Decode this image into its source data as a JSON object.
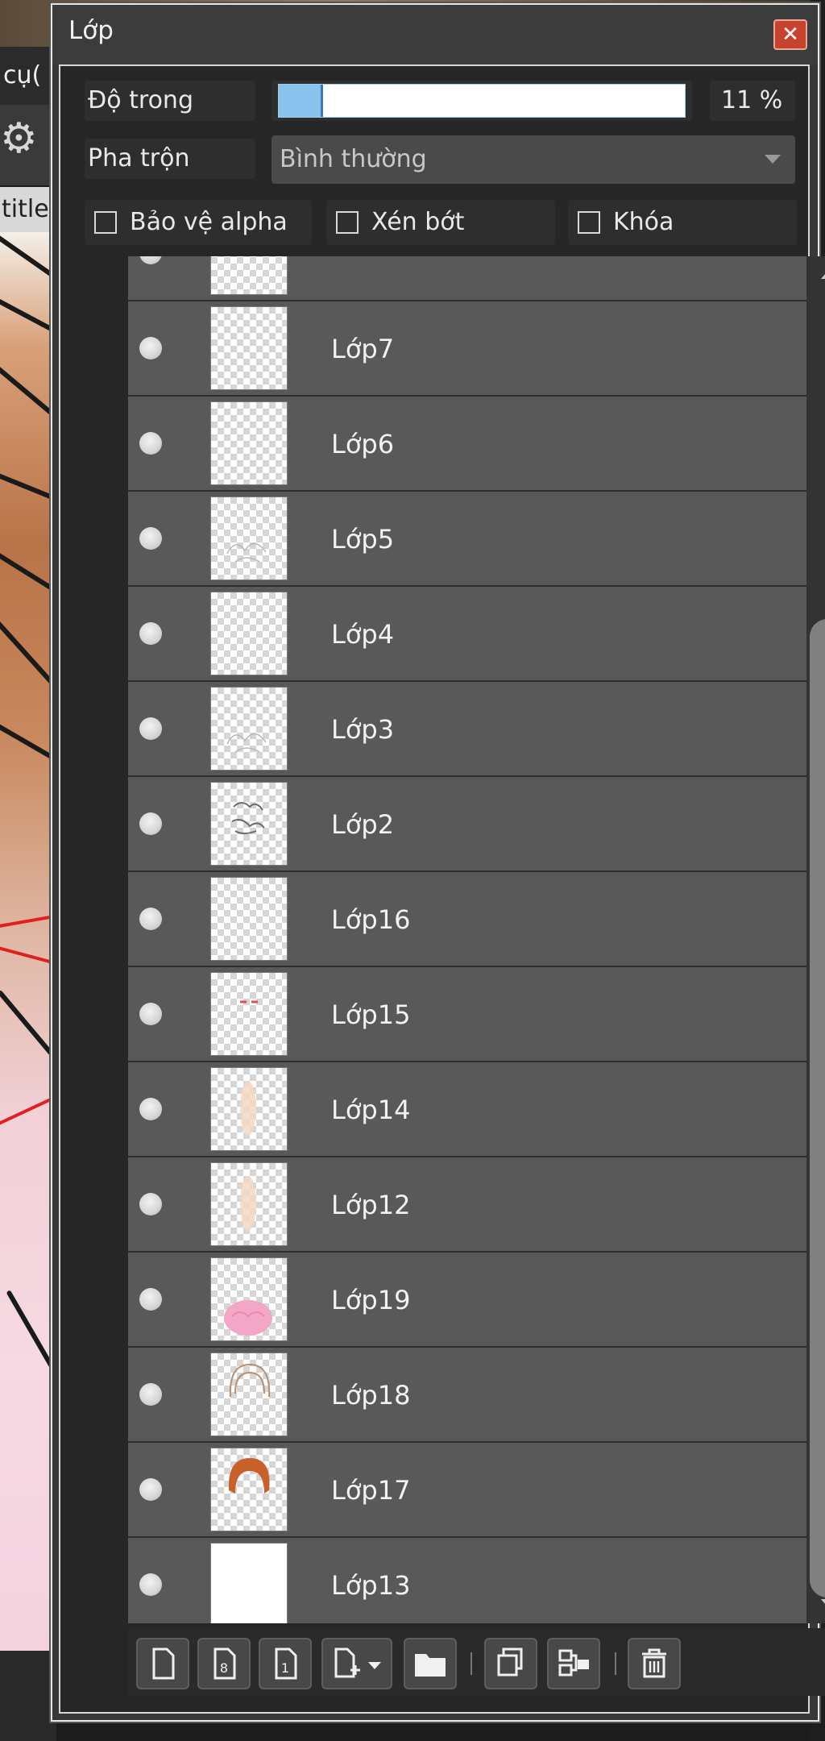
{
  "background_app": {
    "menu_fragment": "cụ(",
    "tab_fragment": "titled"
  },
  "panel": {
    "title": "Lớp",
    "close_icon": "close-icon",
    "opacity": {
      "label": "Độ trong",
      "value_text": "11 %",
      "fraction": 0.11
    },
    "blend": {
      "label": "Pha trộn",
      "value": "Bình thường"
    },
    "checkboxes": [
      {
        "label": "Bảo vệ alpha",
        "checked": false
      },
      {
        "label": "Xén bớt",
        "checked": false
      },
      {
        "label": "Khóa",
        "checked": false
      }
    ]
  },
  "layers": [
    {
      "name": "",
      "thumb": "checker"
    },
    {
      "name": "Lớp7",
      "thumb": "checker"
    },
    {
      "name": "Lớp6",
      "thumb": "checker"
    },
    {
      "name": "Lớp5",
      "thumb": "checker-sketch"
    },
    {
      "name": "Lớp4",
      "thumb": "checker"
    },
    {
      "name": "Lớp3",
      "thumb": "checker-sketch"
    },
    {
      "name": "Lớp2",
      "thumb": "checker-sketch-dark"
    },
    {
      "name": "Lớp16",
      "thumb": "checker"
    },
    {
      "name": "Lớp15",
      "thumb": "checker-red-mark"
    },
    {
      "name": "Lớp14",
      "thumb": "checker-skin"
    },
    {
      "name": "Lớp12",
      "thumb": "checker-skin"
    },
    {
      "name": "Lớp19",
      "thumb": "checker-pink"
    },
    {
      "name": "Lớp18",
      "thumb": "checker-hair-outline"
    },
    {
      "name": "Lớp17",
      "thumb": "checker-orange-hair"
    },
    {
      "name": "Lớp13",
      "thumb": "white"
    }
  ],
  "scroll": {
    "position_fraction": 0.8
  },
  "toolbar": {
    "buttons": [
      {
        "name": "new-layer-button",
        "icon": "page-icon"
      },
      {
        "name": "new-8bit-layer-button",
        "icon": "page-8-icon"
      },
      {
        "name": "new-1bit-layer-button",
        "icon": "page-1-icon"
      },
      {
        "name": "add-layer-menu-button",
        "icon": "page-plus-icon"
      },
      {
        "name": "new-folder-button",
        "icon": "folder-icon"
      },
      {
        "name": "duplicate-layer-button",
        "icon": "duplicate-icon"
      },
      {
        "name": "merge-down-button",
        "icon": "merge-icon"
      },
      {
        "name": "delete-layer-button",
        "icon": "trash-icon"
      }
    ]
  }
}
